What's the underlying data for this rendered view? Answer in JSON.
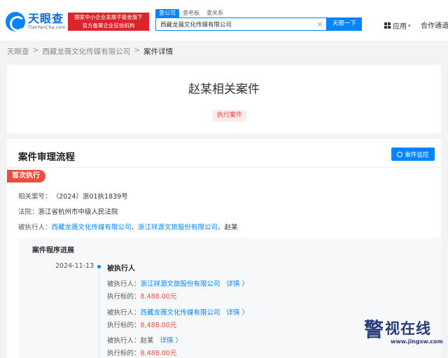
{
  "header": {
    "logo_cn": "天眼查",
    "logo_en": "TianYanCha.com",
    "promo_line1": "国家中小企业发展子基金旗下",
    "promo_line2": "官方备案企业征信机构",
    "search_tabs": [
      "查公司",
      "查老板",
      "查关系"
    ],
    "search_value": "西藏龙薇文化传媒有限公司",
    "clear_glyph": "×",
    "search_button": "天眼一下",
    "app_menu": "应用",
    "coop": "合作通道"
  },
  "breadcrumb": [
    "天眼查",
    "西藏龙薇文化传媒有限公司",
    "案件详情"
  ],
  "title_card": {
    "title": "赵某相关案件",
    "tag": "执行案件"
  },
  "process": {
    "section_title": "案件审理流程",
    "monitor_button": "案件监控",
    "stage": "首次执行",
    "case_no_label": "相关案号：",
    "case_no": "（2024）浙01执1839号",
    "court_label": "法院：",
    "court": "浙江省杭州市中级人民法院",
    "executee_label": "被执行人：",
    "executees": [
      "西藏龙薇文化传媒有限公司",
      "浙江祥源文旅股份有限公司",
      "赵某"
    ],
    "progress_title": "案件程序进展",
    "progress_date": "2024-11-13",
    "progress_head": "被执行人",
    "entries": [
      {
        "label": "被执行人：",
        "name": "浙江祥源文旅股份有限公司",
        "detail": "详情 〉",
        "amount_label": "执行标的：",
        "amount": "8,488.00元"
      },
      {
        "label": "被执行人：",
        "name": "西藏龙薇文化传媒有限公司",
        "detail": "详情 〉",
        "amount_label": "执行标的：",
        "amount": "8,488.00元"
      },
      {
        "label": "被执行人：",
        "name": "赵某",
        "detail": "详情 〉",
        "amount_label": "执行标的：",
        "amount": "8,488.00元"
      }
    ]
  },
  "watermark": {
    "seal": "警",
    "main": "视在线",
    "url": "www.jingsw.com"
  },
  "colors": {
    "brand_blue": "#0084ff",
    "accent_red": "#e94d3c",
    "promo_red": "#d8262c"
  }
}
